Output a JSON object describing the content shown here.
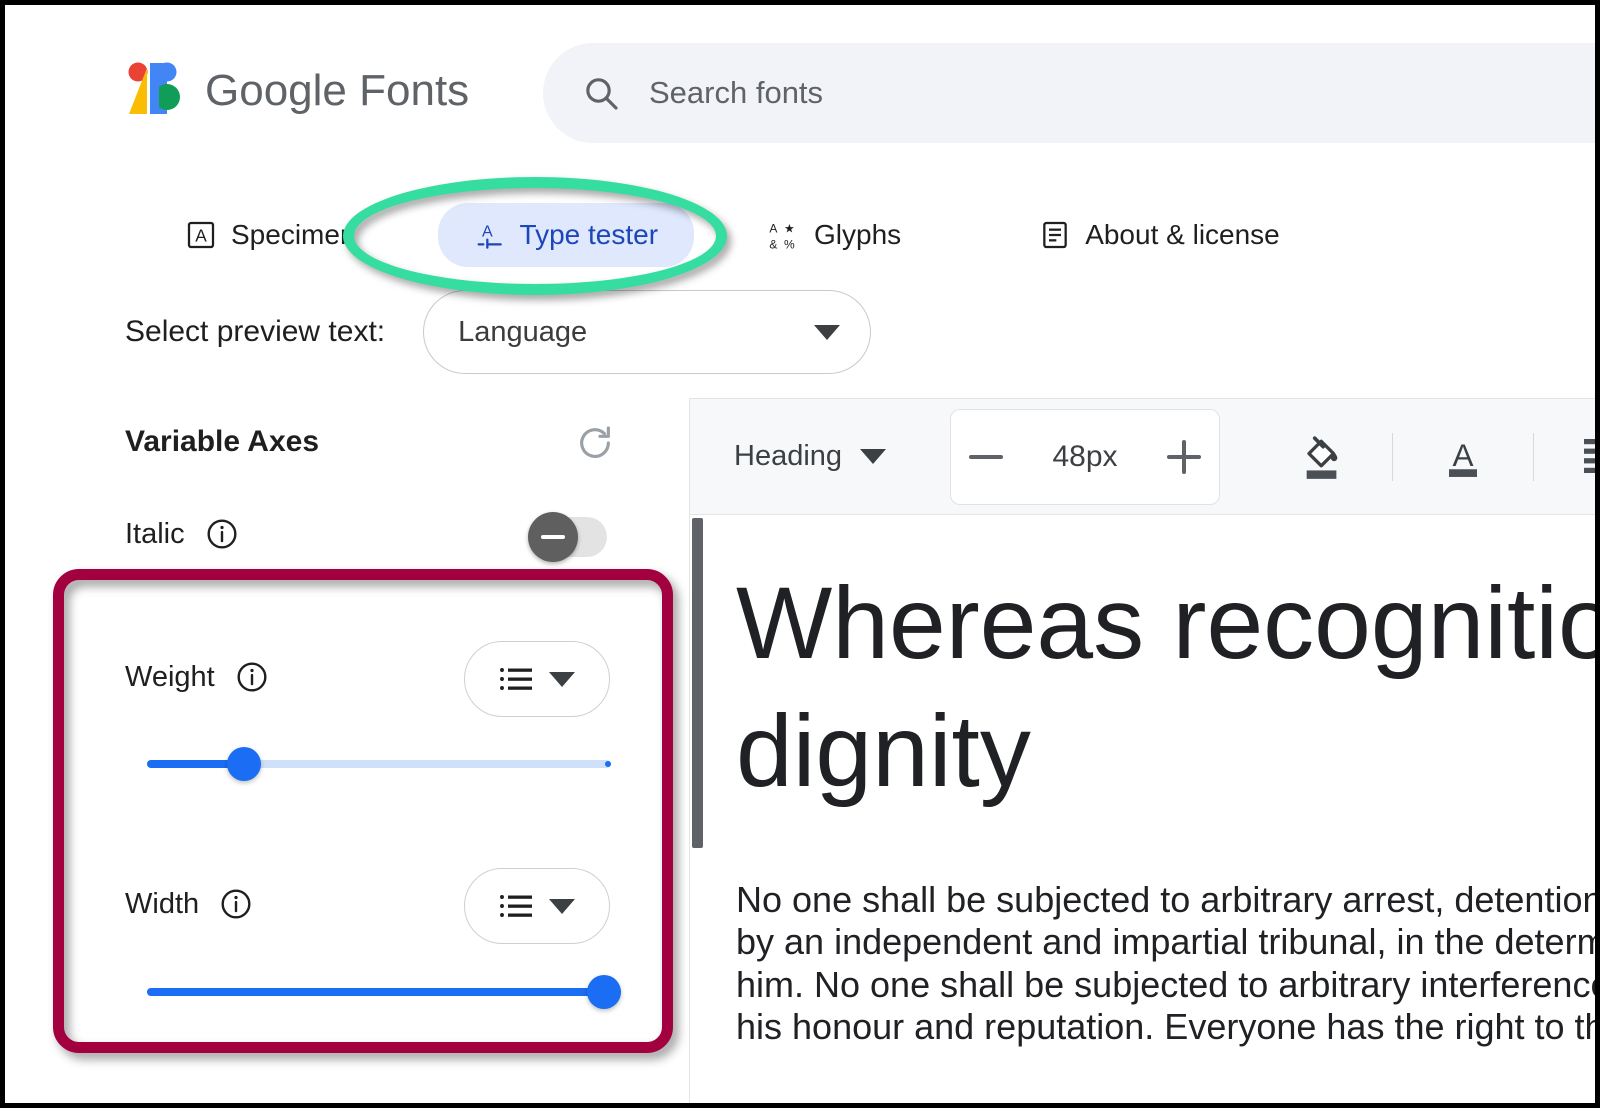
{
  "header": {
    "brand_google": "Google",
    "brand_fonts": "Fonts",
    "search_placeholder": "Search fonts",
    "search_value": ""
  },
  "tabs": [
    {
      "label": "Specimen",
      "icon": "specimen-letter-icon",
      "active": false
    },
    {
      "label": "Type tester",
      "icon": "type-tester-icon",
      "active": true
    },
    {
      "label": "Glyphs",
      "icon": "glyphs-grid-icon",
      "active": false
    },
    {
      "label": "About & license",
      "icon": "document-lines-icon",
      "active": false
    }
  ],
  "preview": {
    "label": "Select preview text:",
    "language_value": "Language",
    "caret_icon": "chevron-down-icon"
  },
  "variable_axes": {
    "title": "Variable Axes",
    "reset_icon": "refresh-icon",
    "axes": [
      {
        "label": "Italic",
        "info_icon": "info-icon",
        "control": "toggle",
        "toggle_state": "off",
        "toggle_knob_icon": "minus-icon"
      },
      {
        "label": "Weight",
        "info_icon": "info-icon",
        "control": "slider",
        "dropdown_icon": "list-icon",
        "dropdown_caret": "chevron-down-icon",
        "slider_percent": 21
      },
      {
        "label": "Width",
        "info_icon": "info-icon",
        "control": "slider",
        "dropdown_icon": "list-icon",
        "dropdown_caret": "chevron-down-icon",
        "slider_percent": 100
      }
    ]
  },
  "editor": {
    "toolbar": {
      "style_value": "Heading",
      "style_caret": "chevron-down-icon",
      "decrease_label": "minus-icon",
      "font_size_value": "48px",
      "increase_label": "plus-icon",
      "icons": [
        "fill-color-icon",
        "text-color-icon",
        "align-left-icon",
        "align-center-icon"
      ]
    },
    "document": {
      "heading_line1": "Whereas recognitio",
      "heading_line2": "dignity",
      "paragraph_lines": [
        "No one shall be subjected to arbitrary arrest, detention or",
        "by an independent and impartial tribunal, in the determina",
        "him. No one shall be subjected to arbitrary interference wi",
        "his honour and reputation. Everyone has the right to the p"
      ]
    }
  },
  "annotations": {
    "ellipse_color": "#35dda0",
    "ellipse_target": "type-tester-tab",
    "box_color": "#a3003f",
    "box_target": "weight-and-width-axes"
  },
  "colors": {
    "accent_blue": "#1b6ef3",
    "tab_active_bg": "#dfe8fd",
    "tab_active_text": "#1c46b9",
    "search_bg": "#f1f3f8",
    "toolbar_bg": "#f7f8fa"
  }
}
